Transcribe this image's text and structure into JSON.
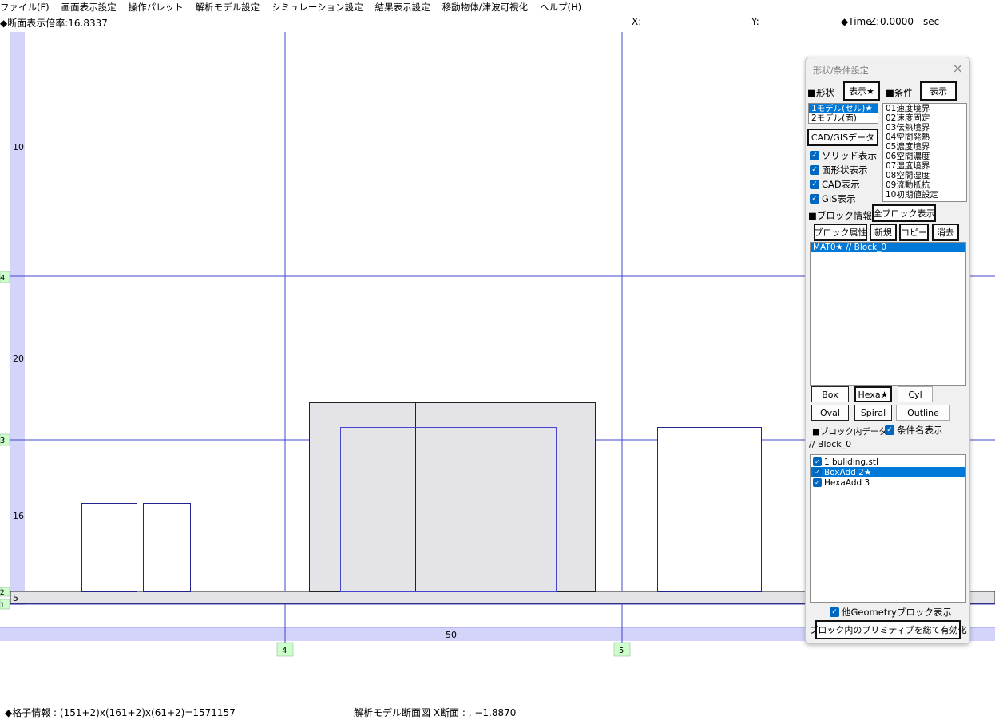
{
  "menu": [
    "ファイル(F)",
    "画面表示設定",
    "操作パレット",
    "解析モデル設定",
    "シミュレーション設定",
    "結果表示設定",
    "移動物体/津波可視化",
    "ヘルプ(H)"
  ],
  "info": {
    "zoom": "◆断面表示倍率:16.8337",
    "x_label": "X:",
    "x_value": "–",
    "y_label": "Y:",
    "y_value": "–",
    "time_label": "◆Time",
    "z_label": "Z:",
    "time_value": "0.0000",
    "time_unit": "sec"
  },
  "status": {
    "grid": "◆格子情報 : (151+2)x(161+2)x(61+2)=1571157",
    "section": "解析モデル断面図 X断面 : , −1.8870"
  },
  "canvas": {
    "left_labels": [
      "10",
      "20",
      "16",
      "5"
    ],
    "left_markers": [
      "4",
      "3",
      "2",
      "1"
    ],
    "bottom_center_label": "50",
    "bottom_markers": [
      "4",
      "5"
    ]
  },
  "panel": {
    "title": "形状/条件設定",
    "close_icon": "×",
    "shape_label": "■形状",
    "shape_show_button": "表示★",
    "cond_label": "■条件",
    "cond_show_button": "表示",
    "models": [
      "1モデル(セル)★",
      "2モデル(面)"
    ],
    "conditions": [
      "01速度境界",
      "02速度固定",
      "03伝熱境界",
      "04空間発熱",
      "05濃度境界",
      "06空間濃度",
      "07湿度境界",
      "08空間湿度",
      "09流動抵抗",
      "10初期値設定"
    ],
    "cad_button": "CAD/GISデータ",
    "checks": [
      "ソリッド表示",
      "面形状表示",
      "CAD表示",
      "GIS表示"
    ],
    "block_info_label": "■ブロック情報",
    "all_block_button": "全ブロック表示",
    "block_attr_button": "ブロック属性",
    "new_button": "新規",
    "copy_button": "コピー",
    "delete_button": "消去",
    "blocks": [
      "MAT0★ // Block_0"
    ],
    "prim_buttons": [
      "Box",
      "Hexa★",
      "Cyl",
      "Oval",
      "Spiral",
      "Outline"
    ],
    "block_data_label": "■ブロック内データ",
    "cond_name_check": "条件名表示",
    "block_name": "// Block_0",
    "block_items": [
      "1 buliding.stl",
      "BoxAdd 2★",
      "HexaAdd 3"
    ],
    "other_geometry_check": "他Geometryブロック表示",
    "enable_all_button": "ブロック内のプリミティブを総て有効化"
  },
  "colors": {
    "axis_band": "#d4d4fa",
    "grid_line": "#4444cc",
    "solid_fill": "#e4e4e8",
    "marker_green": "#ccffcc",
    "selection": "#0078d7"
  }
}
